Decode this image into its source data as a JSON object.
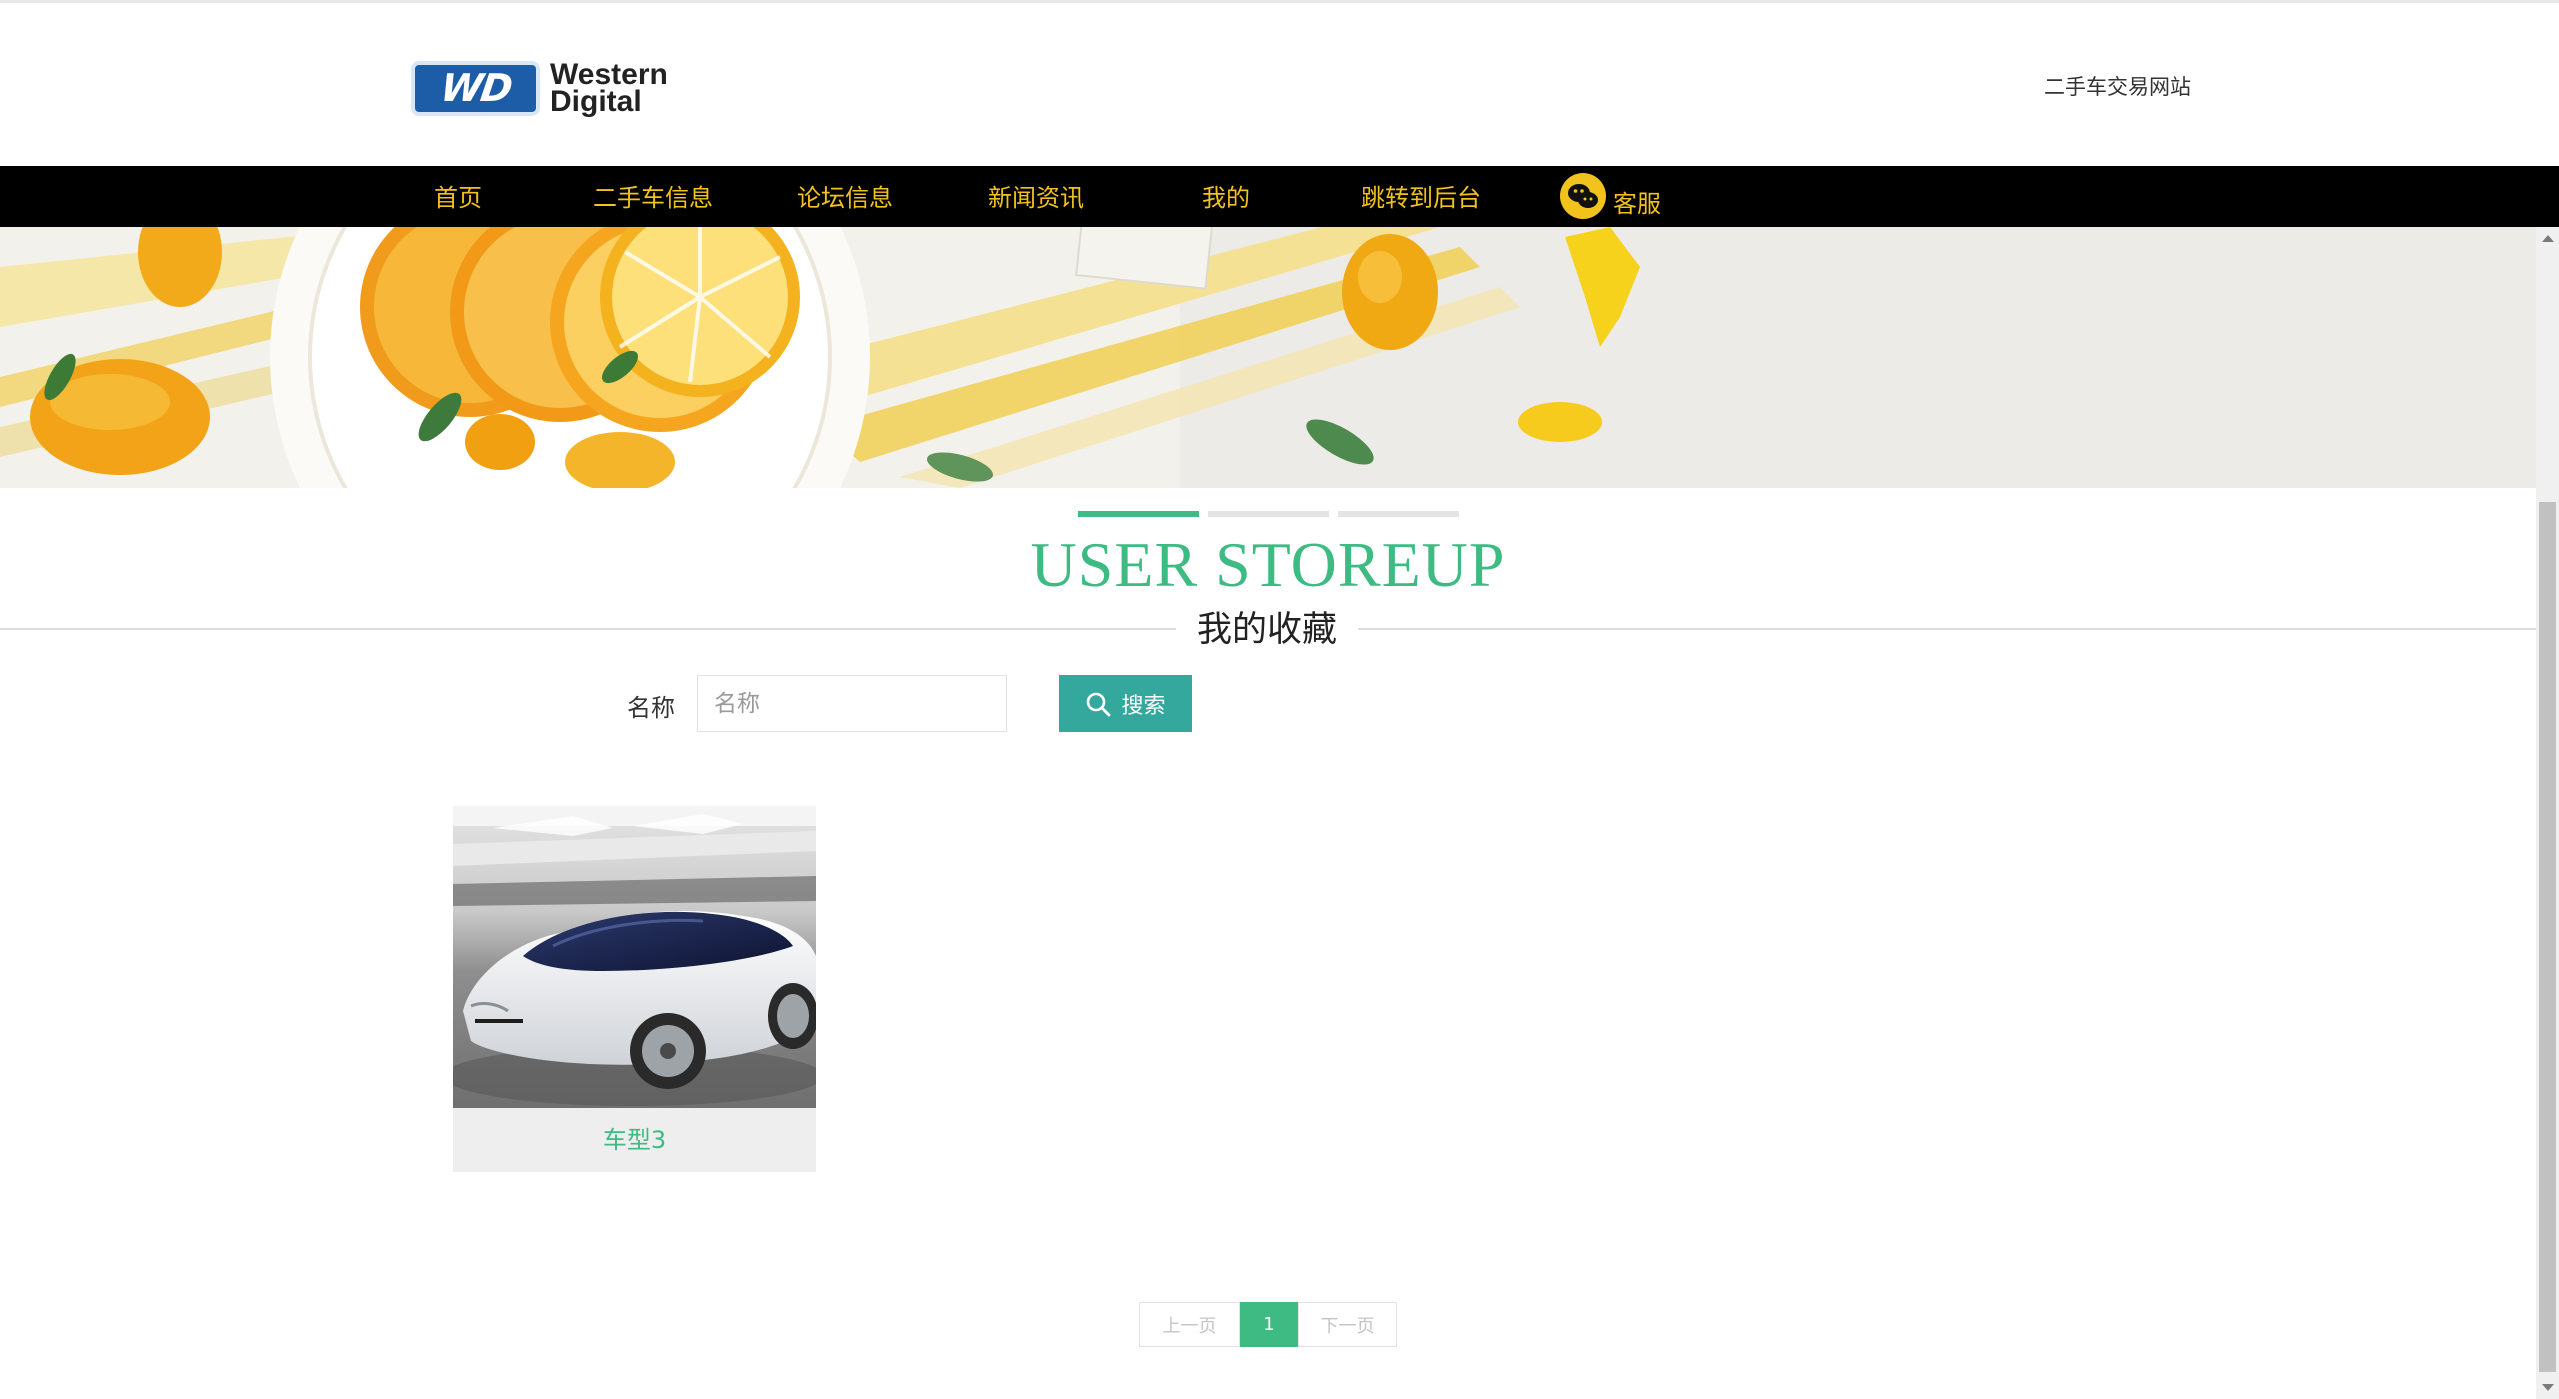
{
  "header": {
    "logo_line1": "Western",
    "logo_line2": "Digital",
    "logo_badge": "WD",
    "site_name": "二手车交易网站"
  },
  "nav": {
    "items": [
      {
        "label": "首页"
      },
      {
        "label": "二手车信息"
      },
      {
        "label": "论坛信息"
      },
      {
        "label": "新闻资讯"
      },
      {
        "label": "我的"
      },
      {
        "label": "跳转到后台"
      },
      {
        "label": "客服",
        "icon": "wechat-icon"
      }
    ]
  },
  "banner": {
    "image": "citrus-banner"
  },
  "section": {
    "title_en": "USER STOREUP",
    "title_cn": "我的收藏"
  },
  "search": {
    "label": "名称",
    "placeholder": "名称",
    "value": "",
    "button_label": "搜索",
    "button_icon": "search-icon"
  },
  "items": [
    {
      "title": "车型3",
      "image": "white-sports-car"
    }
  ],
  "pagination": {
    "prev": "上一页",
    "current": "1",
    "next": "下一页"
  },
  "colors": {
    "accent": "#3dbb83",
    "nav_bg": "#000000",
    "nav_text": "#f2c21d",
    "search_button": "#34a89c",
    "card_bg": "#eeeeee"
  }
}
